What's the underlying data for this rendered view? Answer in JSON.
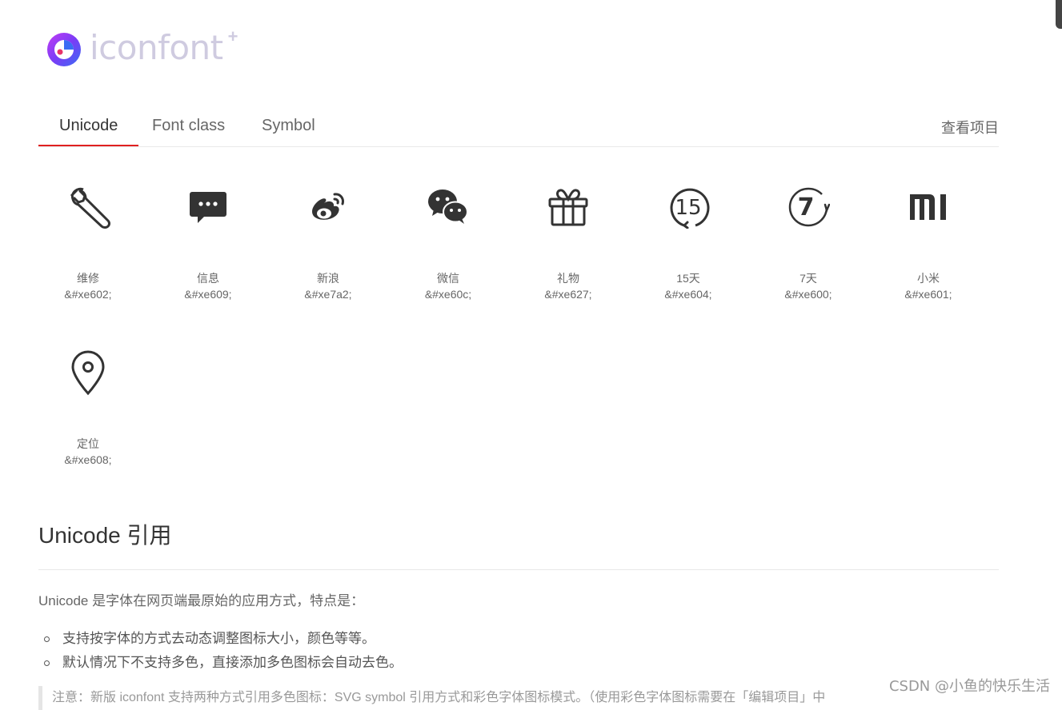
{
  "logo": {
    "text": "iconfont",
    "plus": "+"
  },
  "tabs": [
    {
      "label": "Unicode",
      "active": true
    },
    {
      "label": "Font class",
      "active": false
    },
    {
      "label": "Symbol",
      "active": false
    }
  ],
  "view_project": "查看项目",
  "accent_color": "#e02020",
  "icons": [
    {
      "icon": "wrench-icon",
      "name": "维修",
      "code": "&#xe602;"
    },
    {
      "icon": "message-icon",
      "name": "信息",
      "code": "&#xe609;"
    },
    {
      "icon": "weibo-icon",
      "name": "新浪",
      "code": "&#xe7a2;"
    },
    {
      "icon": "wechat-icon",
      "name": "微信",
      "code": "&#xe60c;"
    },
    {
      "icon": "gift-icon",
      "name": "礼物",
      "code": "&#xe627;"
    },
    {
      "icon": "15-days-icon",
      "name": "15天",
      "code": "&#xe604;",
      "glyph_text": "15"
    },
    {
      "icon": "7-days-icon",
      "name": "7天",
      "code": "&#xe600;",
      "glyph_text": "7"
    },
    {
      "icon": "xiaomi-icon",
      "name": "小米",
      "code": "&#xe601;"
    },
    {
      "icon": "location-icon",
      "name": "定位",
      "code": "&#xe608;"
    }
  ],
  "section": {
    "title": "Unicode 引用",
    "intro": "Unicode 是字体在网页端最原始的应用方式，特点是：",
    "bullets": [
      "支持按字体的方式去动态调整图标大小，颜色等等。",
      "默认情况下不支持多色，直接添加多色图标会自动去色。"
    ],
    "note": "注意：新版 iconfont 支持两种方式引用多色图标：SVG symbol 引用方式和彩色字体图标模式。（使用彩色字体图标需要在「编辑项目」中"
  },
  "watermark": "CSDN @小鱼的快乐生活"
}
